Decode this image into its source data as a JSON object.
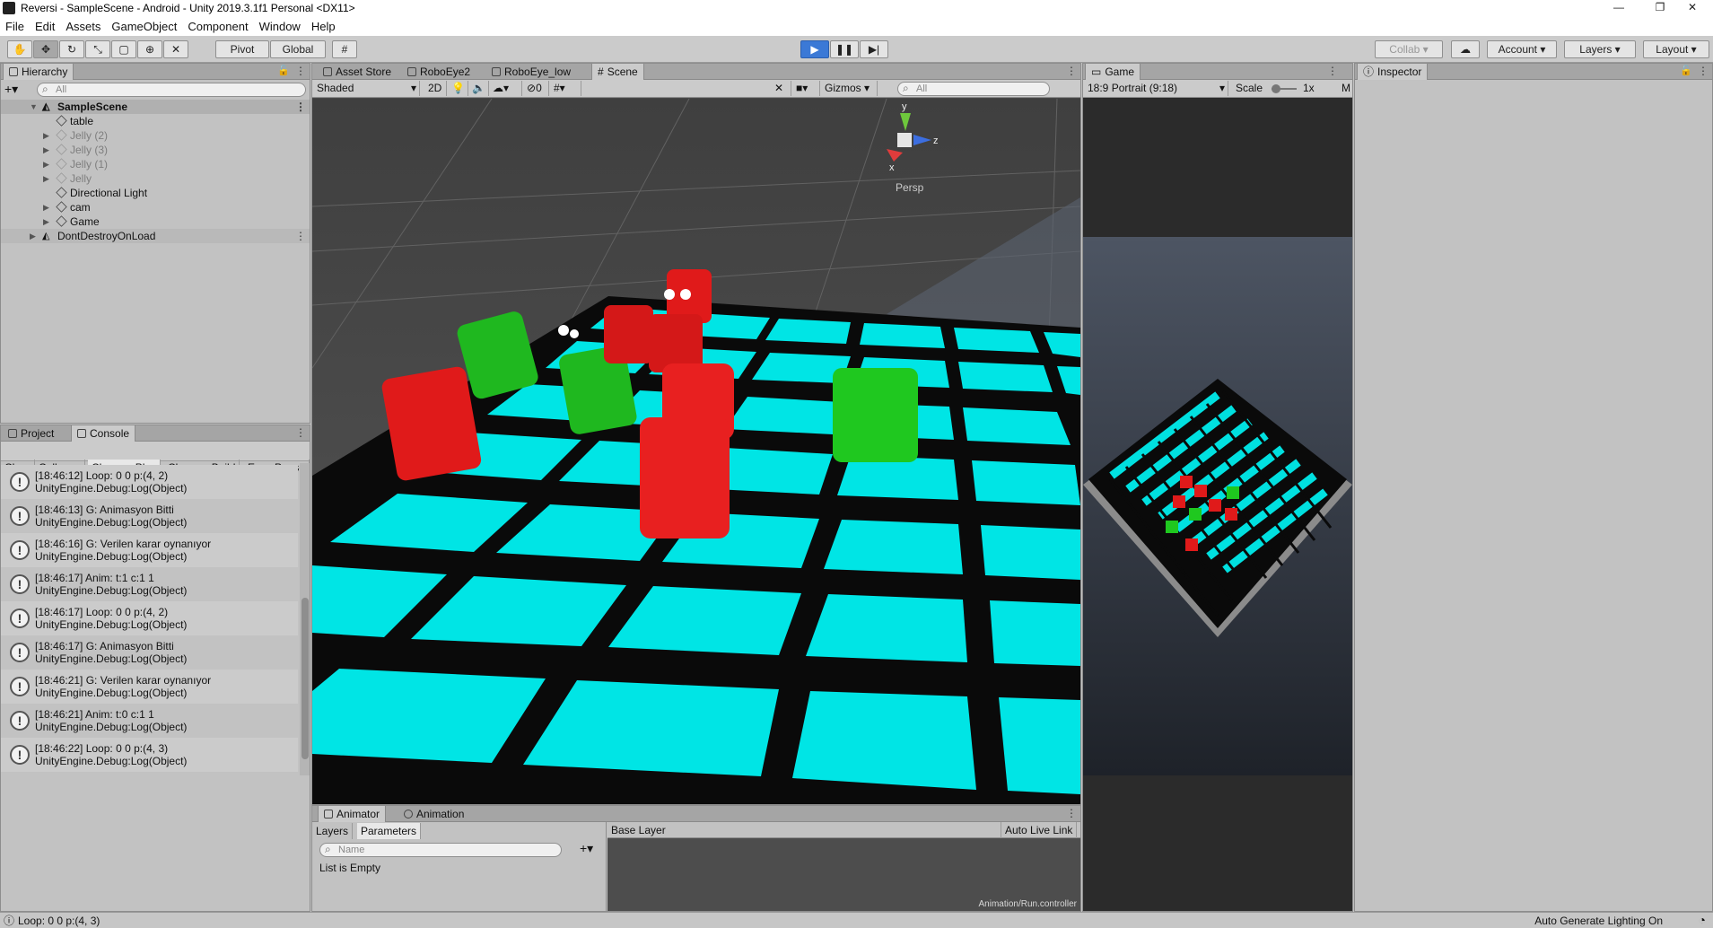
{
  "window": {
    "title": "Reversi - SampleScene - Android - Unity 2019.3.1f1 Personal <DX11>",
    "controls": [
      "—",
      "❐",
      "✕"
    ]
  },
  "menu": [
    "File",
    "Edit",
    "Assets",
    "GameObject",
    "Component",
    "Window",
    "Help"
  ],
  "toolbar": {
    "pivot": "Pivot",
    "global": "Global",
    "collab": "Collab",
    "account": "Account",
    "layers": "Layers",
    "layout": "Layout"
  },
  "hierarchy": {
    "tab": "Hierarchy",
    "search_placeholder": "All",
    "scene": "SampleScene",
    "items": [
      {
        "label": "table",
        "dim": false,
        "expandable": false
      },
      {
        "label": "Jelly (2)",
        "dim": true,
        "expandable": true
      },
      {
        "label": "Jelly (3)",
        "dim": true,
        "expandable": true
      },
      {
        "label": "Jelly (1)",
        "dim": true,
        "expandable": true
      },
      {
        "label": "Jelly",
        "dim": true,
        "expandable": true
      },
      {
        "label": "Directional Light",
        "dim": false,
        "expandable": false
      },
      {
        "label": "cam",
        "dim": false,
        "expandable": true
      },
      {
        "label": "Game",
        "dim": false,
        "expandable": true
      }
    ],
    "ddol": "DontDestroyOnLoad"
  },
  "console": {
    "tabs": [
      "Project",
      "Console"
    ],
    "buttons": [
      "Clear",
      "Collapse",
      "Clear on Play",
      "Clear on Build",
      "Error Pause"
    ],
    "logs": [
      {
        "line1": "[18:46:12] Loop: 0 0 p:(4, 2)",
        "line2": "UnityEngine.Debug:Log(Object)"
      },
      {
        "line1": "[18:46:13] G: Animasyon Bitti",
        "line2": "UnityEngine.Debug:Log(Object)"
      },
      {
        "line1": "[18:46:16] G: Verilen karar oynanıyor",
        "line2": "UnityEngine.Debug:Log(Object)"
      },
      {
        "line1": "[18:46:17] Anim: t:1 c:1 1",
        "line2": "UnityEngine.Debug:Log(Object)"
      },
      {
        "line1": "[18:46:17] Loop: 0 0 p:(4, 2)",
        "line2": "UnityEngine.Debug:Log(Object)"
      },
      {
        "line1": "[18:46:17] G: Animasyon Bitti",
        "line2": "UnityEngine.Debug:Log(Object)"
      },
      {
        "line1": "[18:46:21] G: Verilen karar oynanıyor",
        "line2": "UnityEngine.Debug:Log(Object)"
      },
      {
        "line1": "[18:46:21] Anim: t:0 c:1 1",
        "line2": "UnityEngine.Debug:Log(Object)"
      },
      {
        "line1": "[18:46:22] Loop: 0 0 p:(4, 3)",
        "line2": "UnityEngine.Debug:Log(Object)"
      }
    ]
  },
  "scene": {
    "tabs": [
      "Asset Store",
      "RoboEye2",
      "RoboEye_low",
      "Scene"
    ],
    "shading": "Shaded",
    "mode_2d": "2D",
    "effects_count": "0",
    "gizmos": "Gizmos",
    "search_placeholder": "All",
    "axis_y": "y",
    "axis_z": "z",
    "axis_x": "x",
    "persp": "Persp"
  },
  "game": {
    "tab": "Game",
    "aspect": "18:9 Portrait (9:18)",
    "scale_label": "Scale",
    "scale_value": "1x",
    "trunc": "M"
  },
  "inspector": {
    "tab": "Inspector"
  },
  "animator": {
    "tabs": [
      "Animator",
      "Animation"
    ],
    "layers": "Layers",
    "parameters": "Parameters",
    "name_placeholder": "Name",
    "empty": "List is Empty",
    "base_layer": "Base Layer",
    "auto_live": "Auto Live Link",
    "controller": "Animation/Run.controller"
  },
  "status": {
    "left": "Loop: 0 0 p:(4, 3)",
    "right": "Auto Generate Lighting On"
  }
}
